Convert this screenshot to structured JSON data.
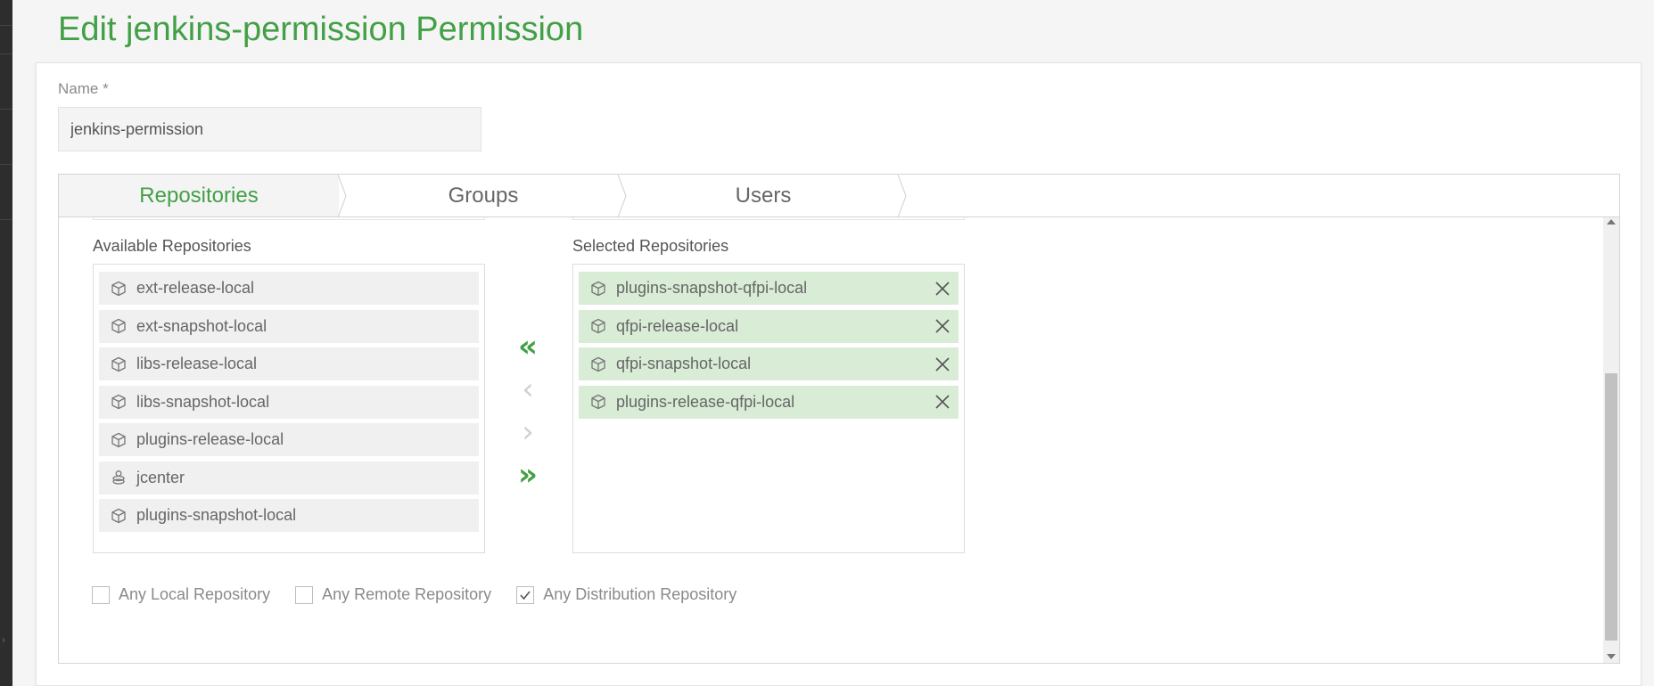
{
  "page": {
    "title": "Edit jenkins-permission Permission"
  },
  "form": {
    "name_label": "Name *",
    "name_value": "jenkins-permission"
  },
  "tabs": [
    {
      "label": "Repositories",
      "active": true
    },
    {
      "label": "Groups",
      "active": false
    },
    {
      "label": "Users",
      "active": false
    }
  ],
  "available": {
    "label": "Available Repositories",
    "items": [
      {
        "label": "ext-release-local",
        "icon": "local-repo-icon"
      },
      {
        "label": "ext-snapshot-local",
        "icon": "local-repo-icon"
      },
      {
        "label": "libs-release-local",
        "icon": "local-repo-icon"
      },
      {
        "label": "libs-snapshot-local",
        "icon": "local-repo-icon"
      },
      {
        "label": "plugins-release-local",
        "icon": "local-repo-icon"
      },
      {
        "label": "jcenter",
        "icon": "remote-repo-icon"
      },
      {
        "label": "plugins-snapshot-local",
        "icon": "local-repo-icon"
      }
    ]
  },
  "selected": {
    "label": "Selected Repositories",
    "items": [
      {
        "label": "plugins-snapshot-qfpi-local",
        "icon": "local-repo-icon"
      },
      {
        "label": "qfpi-release-local",
        "icon": "local-repo-icon"
      },
      {
        "label": "qfpi-snapshot-local",
        "icon": "local-repo-icon"
      },
      {
        "label": "plugins-release-qfpi-local",
        "icon": "local-repo-icon"
      }
    ]
  },
  "transfer": {
    "move_all_left": "«",
    "move_left": "‹",
    "move_right": "›",
    "move_all_right": "»"
  },
  "checkboxes": [
    {
      "label": "Any Local Repository",
      "checked": false
    },
    {
      "label": "Any Remote Repository",
      "checked": false
    },
    {
      "label": "Any Distribution Repository",
      "checked": true
    }
  ],
  "colors": {
    "accent": "#43a047",
    "selected_item_bg": "#d8ecd6",
    "available_item_bg": "#f0f0f0"
  }
}
